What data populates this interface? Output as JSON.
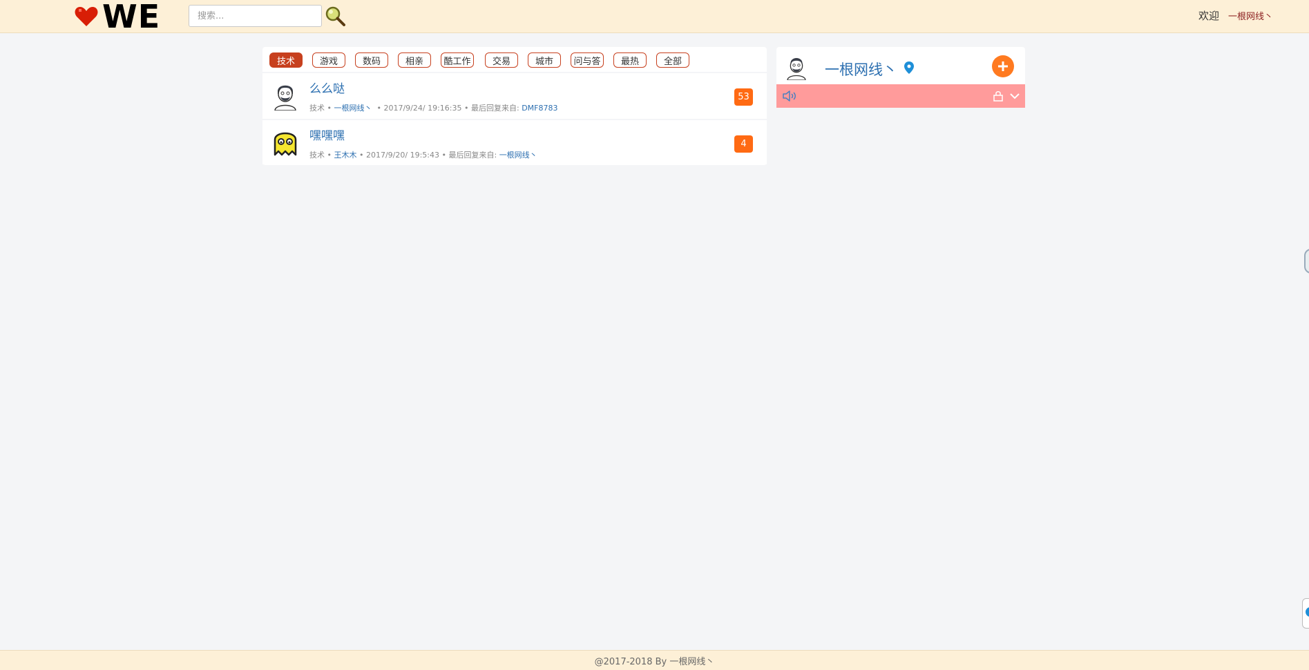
{
  "header": {
    "logo_text": "WE",
    "search_placeholder": "搜索...",
    "welcome_label": "欢迎",
    "username": "一根网线丶"
  },
  "tabs": [
    {
      "label": "技术",
      "active": true
    },
    {
      "label": "游戏",
      "active": false
    },
    {
      "label": "数码",
      "active": false
    },
    {
      "label": "相亲",
      "active": false
    },
    {
      "label": "酷工作",
      "active": false
    },
    {
      "label": "交易",
      "active": false
    },
    {
      "label": "城市",
      "active": false
    },
    {
      "label": "问与答",
      "active": false
    },
    {
      "label": "最热",
      "active": false
    },
    {
      "label": "全部",
      "active": false
    }
  ],
  "topics": [
    {
      "title": "么么哒",
      "category": "技术",
      "author": "一根网线丶",
      "time": "2017/9/24/ 19:16:35",
      "last_reply_label": "最后回复来自:",
      "last_reply_user": "DMF8783",
      "reply_count": "53",
      "avatar": "bearded-man-avatar"
    },
    {
      "title": "嘿嘿嘿",
      "category": "技术",
      "author": "王木木",
      "time": "2017/9/20/ 19:5:43",
      "last_reply_label": "最后回复来自:",
      "last_reply_user": "一根网线丶",
      "reply_count": "4",
      "avatar": "yellow-ghost-avatar"
    }
  ],
  "side": {
    "username": "一根网线丶",
    "icons": [
      "location-pin-icon",
      "add-icon",
      "speaker-icon",
      "lock-icon",
      "chevron-down-icon"
    ]
  },
  "footer": {
    "text": "@2017-2018 By 一根网线丶"
  },
  "colors": {
    "header_bg": "#fdf0d7",
    "accent": "#c7401e",
    "link": "#2c6fb0",
    "badge": "#ff6a13",
    "notice_bg": "#ff9b9b"
  }
}
